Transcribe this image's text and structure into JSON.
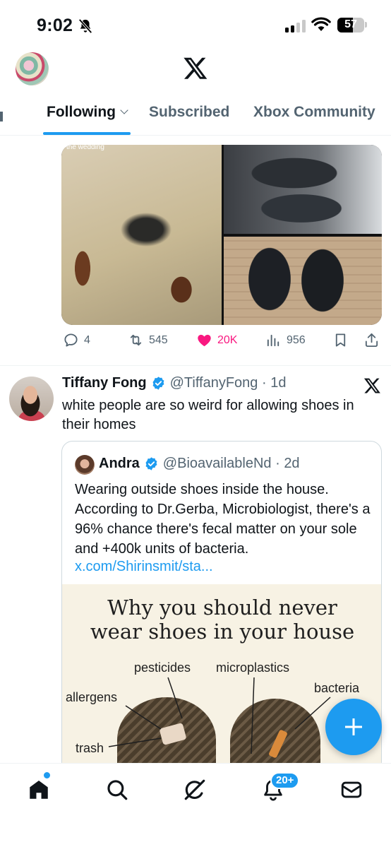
{
  "status_bar": {
    "time": "9:02",
    "battery": "57",
    "battery_level": 0.57
  },
  "header": {
    "logo": "x-logo",
    "avatar": "profile-avatar"
  },
  "tabs": [
    {
      "label": "Following",
      "active": true
    },
    {
      "label": "Subscribed",
      "active": false
    },
    {
      "label": "Xbox Community",
      "active": false
    }
  ],
  "post1": {
    "media_caption": "the wedding",
    "stats": {
      "replies": "4",
      "reposts": "545",
      "likes": "20K",
      "views": "956"
    },
    "like_color": "#f91880"
  },
  "post2": {
    "name": "Tiffany Fong",
    "handle": "@TiffanyFong",
    "time": "1d",
    "text": "white people are so weird for allowing shoes in their homes",
    "quote": {
      "name": "Andra",
      "handle": "@BioavailableNd",
      "time": "2d",
      "text": "Wearing outside shoes inside the house. According to Dr.Gerba, Microbiologist, there's a 96% chance there's fecal matter on your sole and +400k units of bacteria.",
      "link": "x.com/Shirinsmit/sta...",
      "infographic": {
        "title_line1": "Why you should never",
        "title_line2": "wear shoes in your house",
        "labels": [
          "pesticides",
          "microplastics",
          "allergens",
          "bacteria",
          "trash"
        ]
      }
    }
  },
  "nav": {
    "items": [
      "home-icon",
      "search-icon",
      "grok-icon",
      "notifications-icon",
      "messages-icon"
    ],
    "notifications_badge": "20+"
  },
  "colors": {
    "accent": "#1d9bf0",
    "text": "#0f1419",
    "secondary": "#536471"
  }
}
